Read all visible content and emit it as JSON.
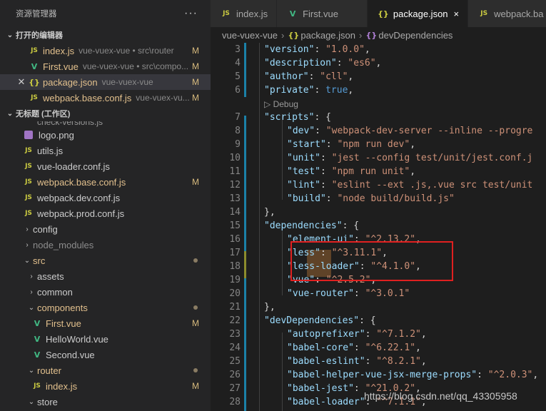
{
  "sidebar": {
    "title": "资源管理器",
    "more": "···",
    "open_editors": {
      "label": "打开的编辑器",
      "items": [
        {
          "name": "index.js",
          "desc": "vue-vuex-vue • src\\router",
          "badge": "M",
          "icon": "JS"
        },
        {
          "name": "First.vue",
          "desc": "vue-vuex-vue • src\\compo...",
          "badge": "M",
          "icon": "V"
        },
        {
          "name": "package.json",
          "desc": "vue-vuex-vue",
          "badge": "M",
          "icon": "{}"
        },
        {
          "name": "webpack.base.conf.js",
          "desc": "vue-vuex-vu...",
          "badge": "M",
          "icon": "JS"
        }
      ]
    },
    "workspace": {
      "label": "无标题 (工作区)",
      "partial_item": "check-versions.js",
      "items": [
        {
          "name": "logo.png",
          "icon": "png"
        },
        {
          "name": "utils.js",
          "icon": "JS"
        },
        {
          "name": "vue-loader.conf.js",
          "icon": "JS"
        },
        {
          "name": "webpack.base.conf.js",
          "icon": "JS",
          "badge": "M"
        },
        {
          "name": "webpack.dev.conf.js",
          "icon": "JS"
        },
        {
          "name": "webpack.prod.conf.js",
          "icon": "JS"
        },
        {
          "name": "config",
          "folder": true
        },
        {
          "name": "node_modules",
          "folder": true
        },
        {
          "name": "src",
          "folder": true,
          "open": true
        },
        {
          "name": "assets",
          "folder": true
        },
        {
          "name": "common",
          "folder": true
        },
        {
          "name": "components",
          "folder": true,
          "open": true
        },
        {
          "name": "First.vue",
          "icon": "V",
          "badge": "M"
        },
        {
          "name": "HelloWorld.vue",
          "icon": "V"
        },
        {
          "name": "Second.vue",
          "icon": "V"
        },
        {
          "name": "router",
          "folder": true,
          "open": true
        },
        {
          "name": "index.js",
          "icon": "JS",
          "badge": "M"
        },
        {
          "name": "store",
          "folder": true,
          "open": true
        }
      ]
    }
  },
  "tabs": [
    {
      "label": "index.js",
      "icon": "JS"
    },
    {
      "label": "First.vue",
      "icon": "V"
    },
    {
      "label": "package.json",
      "icon": "{}",
      "close": "×"
    },
    {
      "label": "webpack.ba",
      "icon": "JS"
    }
  ],
  "breadcrumb": {
    "root": "vue-vuex-vue",
    "file": "package.json",
    "symbol": "devDependencies"
  },
  "codelens": "Debug",
  "code_lines": [
    {
      "n": "3",
      "key": "\"version\"",
      "val": "\"1.0.0\""
    },
    {
      "n": "4",
      "key": "\"description\"",
      "val": "\"es6\""
    },
    {
      "n": "5",
      "key": "\"author\"",
      "val": "\"cll\""
    },
    {
      "n": "6",
      "key": "\"private\"",
      "val": "true"
    },
    {
      "n": "7",
      "key": "\"scripts\"",
      "val": "{"
    },
    {
      "n": "8",
      "key": "\"dev\"",
      "val": "\"webpack-dev-server --inline --progre"
    },
    {
      "n": "9",
      "key": "\"start\"",
      "val": "\"npm run dev\""
    },
    {
      "n": "10",
      "key": "\"unit\"",
      "val": "\"jest --config test/unit/jest.conf.j"
    },
    {
      "n": "11",
      "key": "\"test\"",
      "val": "\"npm run unit\""
    },
    {
      "n": "12",
      "key": "\"lint\"",
      "val": "\"eslint --ext .js,.vue src test/unit"
    },
    {
      "n": "13",
      "key": "\"build\"",
      "val": "\"node build/build.js\""
    },
    {
      "n": "14",
      "key": "",
      "val": "},"
    },
    {
      "n": "15",
      "key": "\"dependencies\"",
      "val": "{"
    },
    {
      "n": "16",
      "key": "\"element-ui\"",
      "val": "\"^2.13.2\""
    },
    {
      "n": "17",
      "key": "\"less\"",
      "val": "\"^3.11.1\""
    },
    {
      "n": "18",
      "key": "\"less-loader\"",
      "val": "\"^4.1.0\""
    },
    {
      "n": "19",
      "key": "\"vue\"",
      "val": "\"^2.5.2\""
    },
    {
      "n": "20",
      "key": "\"vue-router\"",
      "val": "\"^3.0.1\""
    },
    {
      "n": "21",
      "key": "",
      "val": "},"
    },
    {
      "n": "22",
      "key": "\"devDependencies\"",
      "val": "{"
    },
    {
      "n": "23",
      "key": "\"autoprefixer\"",
      "val": "\"^7.1.2\""
    },
    {
      "n": "24",
      "key": "\"babel-core\"",
      "val": "\"^6.22.1\""
    },
    {
      "n": "25",
      "key": "\"babel-eslint\"",
      "val": "\"^8.2.1\""
    },
    {
      "n": "26",
      "key": "\"babel-helper-vue-jsx-merge-props\"",
      "val": "\"^2.0.3\""
    },
    {
      "n": "27",
      "key": "\"babel-jest\"",
      "val": "\"^21.0.2\""
    },
    {
      "n": "28",
      "key": "\"babel-loader\"",
      "val": "\"^7.1.1\""
    }
  ],
  "watermark": "https://blog.csdn.net/qq_43305958",
  "colors": {
    "key": "#9cdcfe",
    "string": "#ce9178",
    "keyword": "#569cd6",
    "modified": "#e2c08d",
    "annotation": "#e02020"
  }
}
